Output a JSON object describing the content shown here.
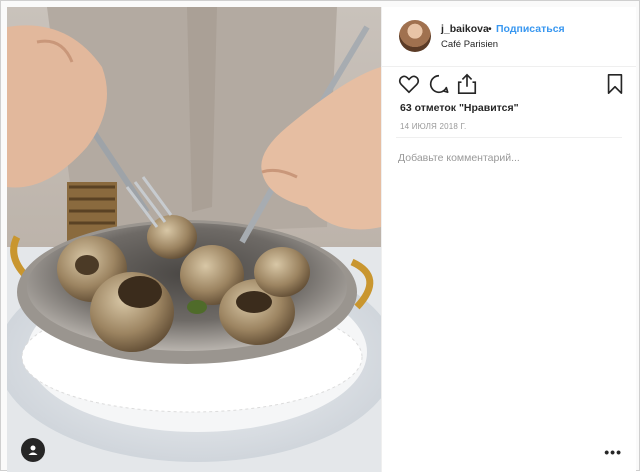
{
  "post": {
    "username": "j_baikova",
    "separator": "•",
    "follow_label": "Подписаться",
    "location": "Café Parisien",
    "likes": "63 отметок \"Нравится\"",
    "date": "14 ИЮЛЯ 2018 Г.",
    "comment_placeholder": "Добавьте комментарий...",
    "more_label": "•••"
  },
  "icons": {
    "like": "heart-icon",
    "comment": "comment-icon",
    "share": "share-icon",
    "save": "bookmark-icon",
    "profile": "user-icon"
  },
  "colors": {
    "link": "#3897f0",
    "text": "#262626",
    "muted": "#999999"
  }
}
